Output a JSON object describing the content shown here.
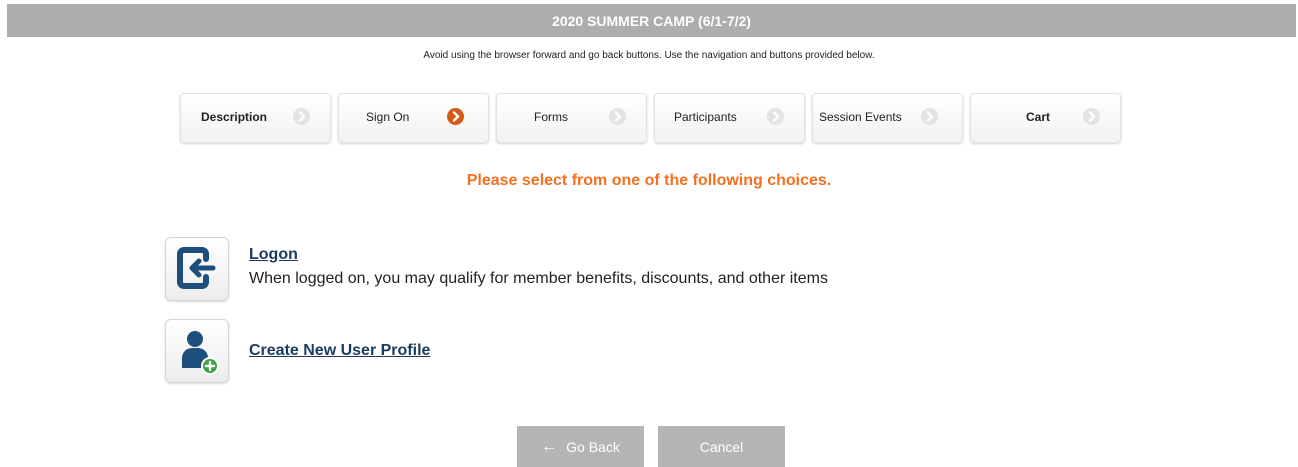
{
  "header": {
    "title": "2020 SUMMER CAMP (6/1-7/2)"
  },
  "notice": "Avoid using the browser forward and go back buttons. Use the navigation and buttons provided below.",
  "steps": [
    {
      "label": "Description",
      "icon": "chevron-right-icon"
    },
    {
      "label": "Sign On",
      "icon": "chevron-right-icon",
      "active": true
    },
    {
      "label": "Forms",
      "icon": "chevron-right-icon"
    },
    {
      "label": "Participants",
      "icon": "chevron-right-icon"
    },
    {
      "label": "Session Events",
      "icon": "chevron-right-icon"
    },
    {
      "label": "Cart",
      "icon": "chevron-right-icon"
    }
  ],
  "prompt": "Please select from one of the following choices.",
  "options": {
    "logon": {
      "title": "Logon",
      "description": "When logged on, you may qualify for member benefits, discounts, and other items",
      "icon": "logon-icon"
    },
    "create": {
      "title": "Create New User Profile",
      "icon": "add-user-icon"
    }
  },
  "buttons": {
    "back": "Go Back",
    "back_icon": "arrow-left-icon",
    "cancel": "Cancel"
  },
  "colors": {
    "title_bar": "#adadad",
    "prompt": "#f27120",
    "active_step": "#d75a1a",
    "icon_blue": "#1e4f7c",
    "add_green": "#3fa140"
  }
}
